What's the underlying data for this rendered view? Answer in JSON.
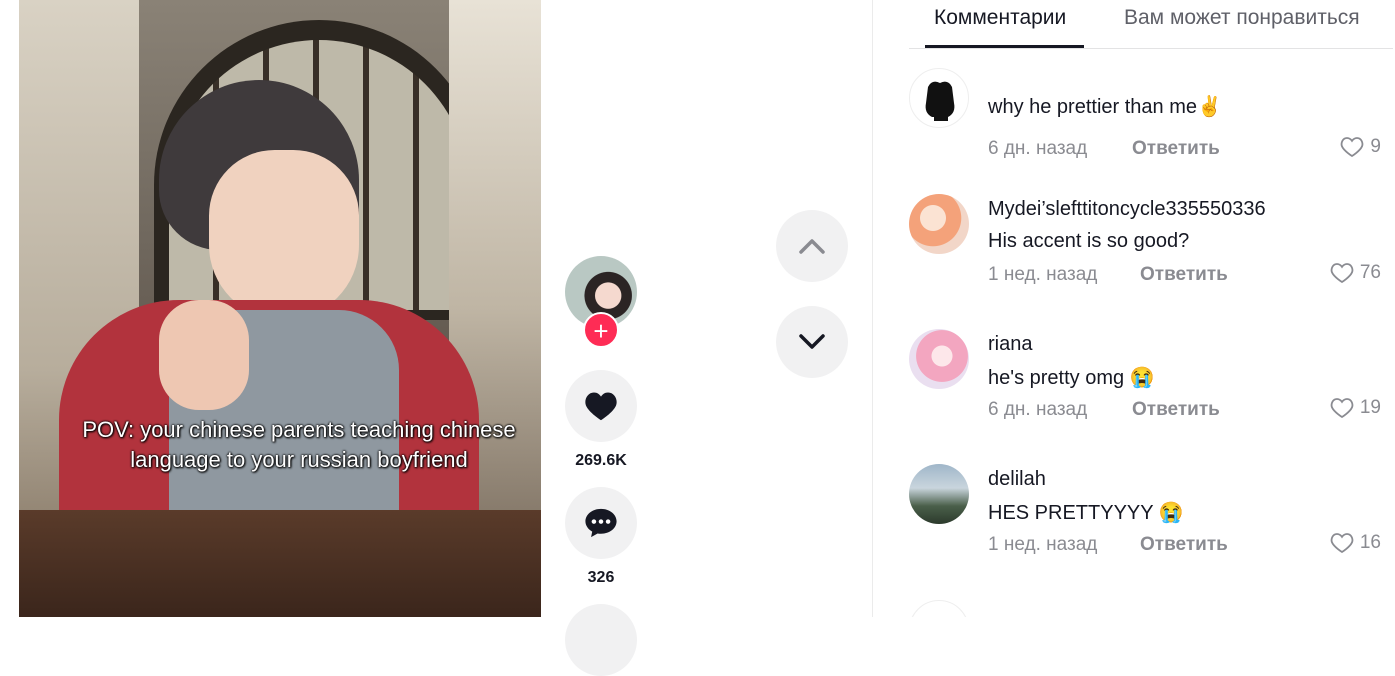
{
  "video": {
    "caption": "POV: your chinese parents teaching chinese language to your russian boyfriend"
  },
  "actions": {
    "likes": "269.6K",
    "comments": "326"
  },
  "tabs": {
    "comments": "Комментарии",
    "suggested": "Вам может понравиться"
  },
  "comments": [
    {
      "user": "",
      "text": "why he prettier than me✌",
      "time": "6 дн. назад",
      "reply": "Ответить",
      "likes": "9"
    },
    {
      "user": "Mydei’slefttitoncycle335550336",
      "text": "His accent is so good?",
      "time": "1 нед. назад",
      "reply": "Ответить",
      "likes": "76"
    },
    {
      "user": "riana",
      "text": "he's pretty omg 😭",
      "time": "6 дн. назад",
      "reply": "Ответить",
      "likes": "19"
    },
    {
      "user": "delilah",
      "text": "HES PRETTYYYY 😭",
      "time": "1 нед. назад",
      "reply": "Ответить",
      "likes": "16"
    }
  ],
  "colors": {
    "accent": "#fe2c55",
    "text": "#161823",
    "muted": "#8a8b91"
  }
}
